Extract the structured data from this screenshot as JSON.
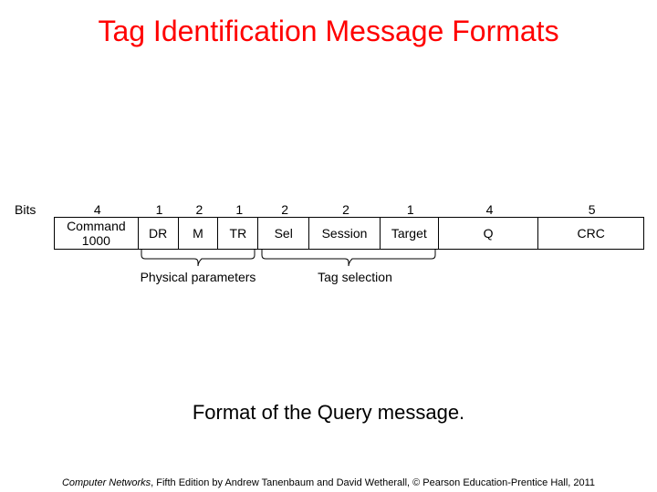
{
  "title": "Tag Identification Message Formats",
  "bits_label": "Bits",
  "fields": [
    {
      "bits": "4",
      "name": "Command\n1000"
    },
    {
      "bits": "1",
      "name": "DR"
    },
    {
      "bits": "2",
      "name": "M"
    },
    {
      "bits": "1",
      "name": "TR"
    },
    {
      "bits": "2",
      "name": "Sel"
    },
    {
      "bits": "2",
      "name": "Session"
    },
    {
      "bits": "1",
      "name": "Target"
    },
    {
      "bits": "4",
      "name": "Q"
    },
    {
      "bits": "5",
      "name": "CRC"
    }
  ],
  "annotations": {
    "physical": "Physical parameters",
    "tag_selection": "Tag selection"
  },
  "caption": "Format of the Query message.",
  "footer": {
    "book": "Computer Networks",
    "rest": ", Fifth Edition by Andrew Tanenbaum and David Wetherall, © Pearson Education-Prentice Hall, 2011"
  }
}
